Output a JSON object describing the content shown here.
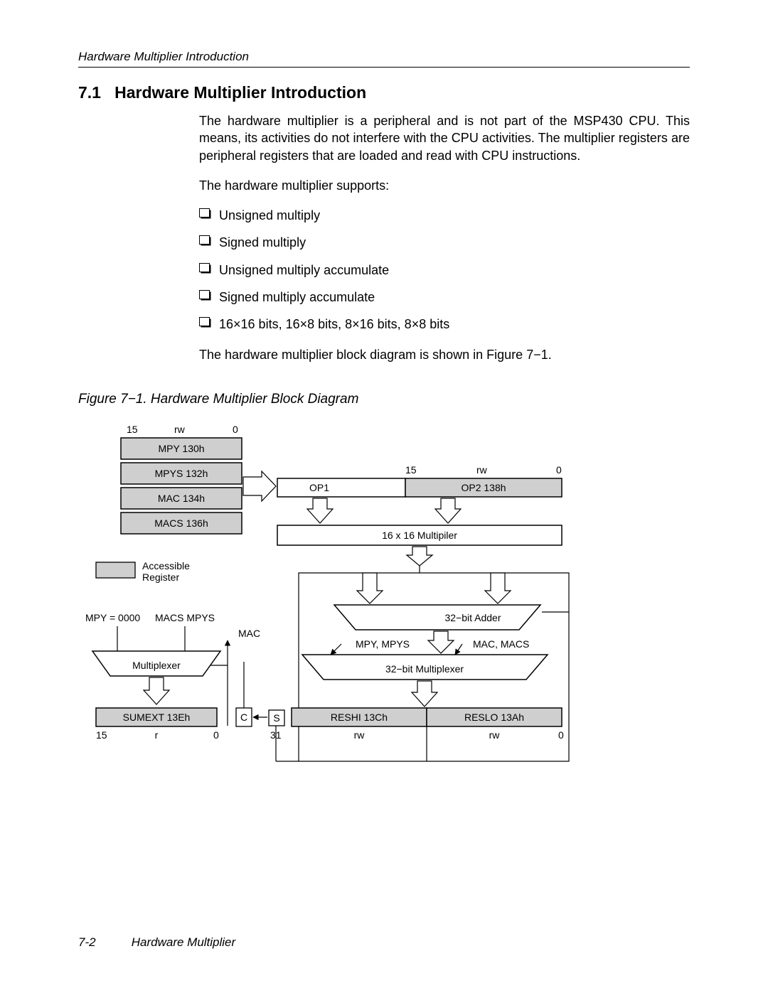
{
  "page_header": "Hardware Multiplier Introduction",
  "section_number": "7.1",
  "section_title": "Hardware Multiplier Introduction",
  "para1": "The hardware multiplier is a peripheral and is not part of the MSP430 CPU. This means, its activities do not interfere with the CPU activities. The multiplier registers are peripheral registers that are loaded and read with CPU instructions.",
  "para2": "The hardware multiplier supports:",
  "bullets": [
    "Unsigned multiply",
    "Signed multiply",
    "Unsigned multiply accumulate",
    "Signed multiply accumulate",
    "16×16 bits, 16×8 bits, 8×16 bits, 8×8 bits"
  ],
  "para3": "The hardware multiplier block diagram is shown in Figure 7−1.",
  "figure_caption": "Figure 7−1. Hardware Multiplier Block Diagram",
  "diagram": {
    "left_regs": [
      "MPY 130h",
      "MPYS 132h",
      "MAC 134h",
      "MACS 136h"
    ],
    "left_bits": {
      "hi": "15",
      "rw": "rw",
      "lo": "0"
    },
    "op1": "OP1",
    "op2": "OP2 138h",
    "op2_bits": {
      "hi": "15",
      "rw": "rw",
      "lo": "0"
    },
    "mult": "16 x 16 Multipiler",
    "legend": "Accessible\nRegister",
    "mpy0": "MPY = 0000",
    "macs_mpys": "MACS MPYS",
    "mac_side": "MAC",
    "left_mux": "Multiplexer",
    "sumext": "SUMEXT 13Eh",
    "sumext_bits": {
      "hi": "15",
      "r": "r",
      "lo": "0"
    },
    "adder": "32−bit Adder",
    "mpy_mpys": "MPY, MPYS",
    "mac_macs": "MAC, MACS",
    "right_mux": "32−bit Multiplexer",
    "c": "C",
    "s": "S",
    "reshi": "RESHI 13Ch",
    "reslo": "RESLO 13Ah",
    "res_bits": {
      "hi": "31",
      "rw1": "rw",
      "rw2": "rw",
      "lo": "0"
    }
  },
  "footer_page": "7-2",
  "footer_title": "Hardware Multiplier"
}
